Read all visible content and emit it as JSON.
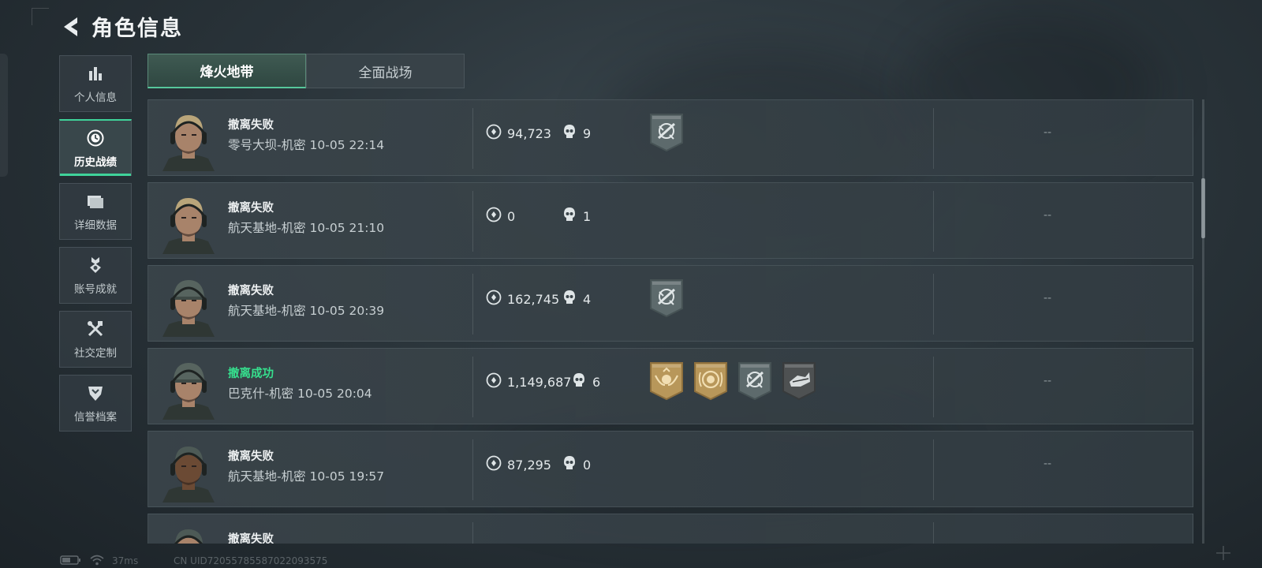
{
  "header": {
    "title": "角色信息"
  },
  "sidebar": {
    "items": [
      {
        "label": "个人信息",
        "icon": "bar-chart-icon",
        "active": false
      },
      {
        "label": "历史战绩",
        "icon": "clock-icon",
        "active": true
      },
      {
        "label": "详细数据",
        "icon": "folder-icon",
        "active": false
      },
      {
        "label": "账号成就",
        "icon": "medal-icon",
        "active": false
      },
      {
        "label": "社交定制",
        "icon": "tools-icon",
        "active": false
      },
      {
        "label": "信誉档案",
        "icon": "shield-icon",
        "active": false
      }
    ]
  },
  "tabs": [
    {
      "label": "烽火地带",
      "active": true
    },
    {
      "label": "全面战场",
      "active": false
    }
  ],
  "matches": [
    {
      "result": "撤离失败",
      "success": false,
      "map_time": "零号大坝-机密 10-05 22:14",
      "assets": "94,723",
      "kills": "9",
      "badges": [
        "gray-rifle"
      ],
      "extra": "--"
    },
    {
      "result": "撤离失败",
      "success": false,
      "map_time": "航天基地-机密 10-05 21:10",
      "assets": "0",
      "kills": "1",
      "badges": [],
      "extra": "--"
    },
    {
      "result": "撤离失败",
      "success": false,
      "map_time": "航天基地-机密 10-05 20:39",
      "assets": "162,745",
      "kills": "4",
      "badges": [
        "gray-rifle"
      ],
      "extra": "--"
    },
    {
      "result": "撤离成功",
      "success": true,
      "map_time": "巴克什-机密 10-05 20:04",
      "assets": "1,149,687",
      "kills": "6",
      "badges": [
        "gold-wings",
        "gold-coin",
        "gray-rifle",
        "dark-hand"
      ],
      "extra": "--"
    },
    {
      "result": "撤离失败",
      "success": false,
      "map_time": "航天基地-机密 10-05 19:57",
      "assets": "87,295",
      "kills": "0",
      "badges": [],
      "extra": "--"
    },
    {
      "result": "撤离失败",
      "success": false,
      "map_time": "",
      "assets": "",
      "kills": "",
      "badges": [],
      "extra": ""
    }
  ],
  "footer": {
    "ping": "37ms",
    "uid": "CN UID7205578558702209357​5"
  },
  "colors": {
    "accent": "#3fd39a",
    "success": "#36e08e",
    "row_bg": "#3a444a"
  }
}
